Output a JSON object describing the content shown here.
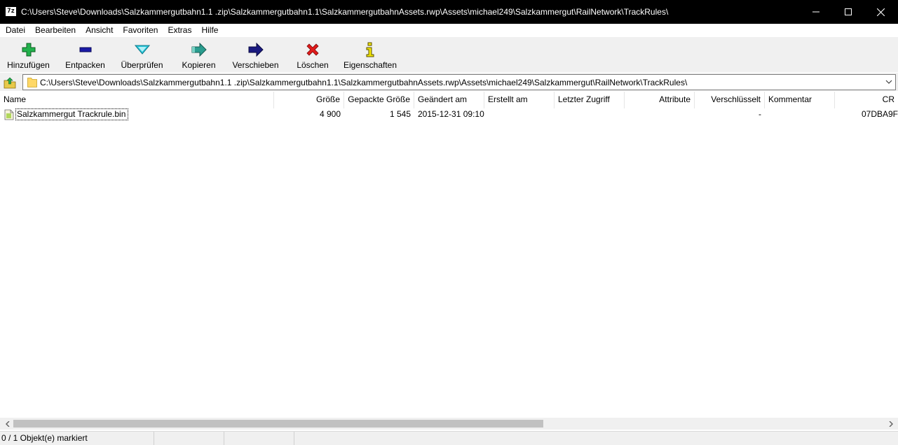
{
  "window": {
    "app_icon_text": "7z",
    "title": "C:\\Users\\Steve\\Downloads\\Salzkammergutbahn1.1 .zip\\Salzkammergutbahn1.1\\SalzkammergutbahnAssets.rwp\\Assets\\michael249\\Salzkammergut\\RailNetwork\\TrackRules\\",
    "controls": {
      "minimize": "minimize-icon",
      "maximize": "maximize-icon",
      "close": "close-icon"
    }
  },
  "menu": [
    "Datei",
    "Bearbeiten",
    "Ansicht",
    "Favoriten",
    "Extras",
    "Hilfe"
  ],
  "toolbar": [
    {
      "label": "Hinzufügen",
      "icon": "plus-icon",
      "color": "#22b14c"
    },
    {
      "label": "Entpacken",
      "icon": "minus-icon",
      "color": "#1a1aa6"
    },
    {
      "label": "Überprüfen",
      "icon": "check-chevron-icon",
      "color": "#26c6da"
    },
    {
      "label": "Kopieren",
      "icon": "copy-arrow-icon",
      "color": "#2a9d8f"
    },
    {
      "label": "Verschieben",
      "icon": "move-arrow-icon",
      "color": "#1a1a80"
    },
    {
      "label": "Löschen",
      "icon": "delete-x-icon",
      "color": "#e01b1b"
    },
    {
      "label": "Eigenschaften",
      "icon": "info-icon",
      "color": "#f2e600"
    }
  ],
  "address": {
    "path": "C:\\Users\\Steve\\Downloads\\Salzkammergutbahn1.1 .zip\\Salzkammergutbahn1.1\\SalzkammergutbahnAssets.rwp\\Assets\\michael249\\Salzkammergut\\RailNetwork\\TrackRules\\"
  },
  "columns": {
    "name": "Name",
    "size": "Größe",
    "packed": "Gepackte Größe",
    "modified": "Geändert am",
    "created": "Erstellt am",
    "accessed": "Letzter Zugriff",
    "attributes": "Attribute",
    "encrypted": "Verschlüsselt",
    "comment": "Kommentar",
    "crc": "CR"
  },
  "files": [
    {
      "name": "Salzkammergut Trackrule.bin",
      "size": "4 900",
      "packed": "1 545",
      "modified": "2015-12-31 09:10",
      "created": "",
      "accessed": "",
      "attributes": "",
      "encrypted": "-",
      "comment": "",
      "crc": "07DBA9F"
    }
  ],
  "status": {
    "selection": "0 / 1 Objekt(e) markiert",
    "seg2": "",
    "seg3": ""
  }
}
